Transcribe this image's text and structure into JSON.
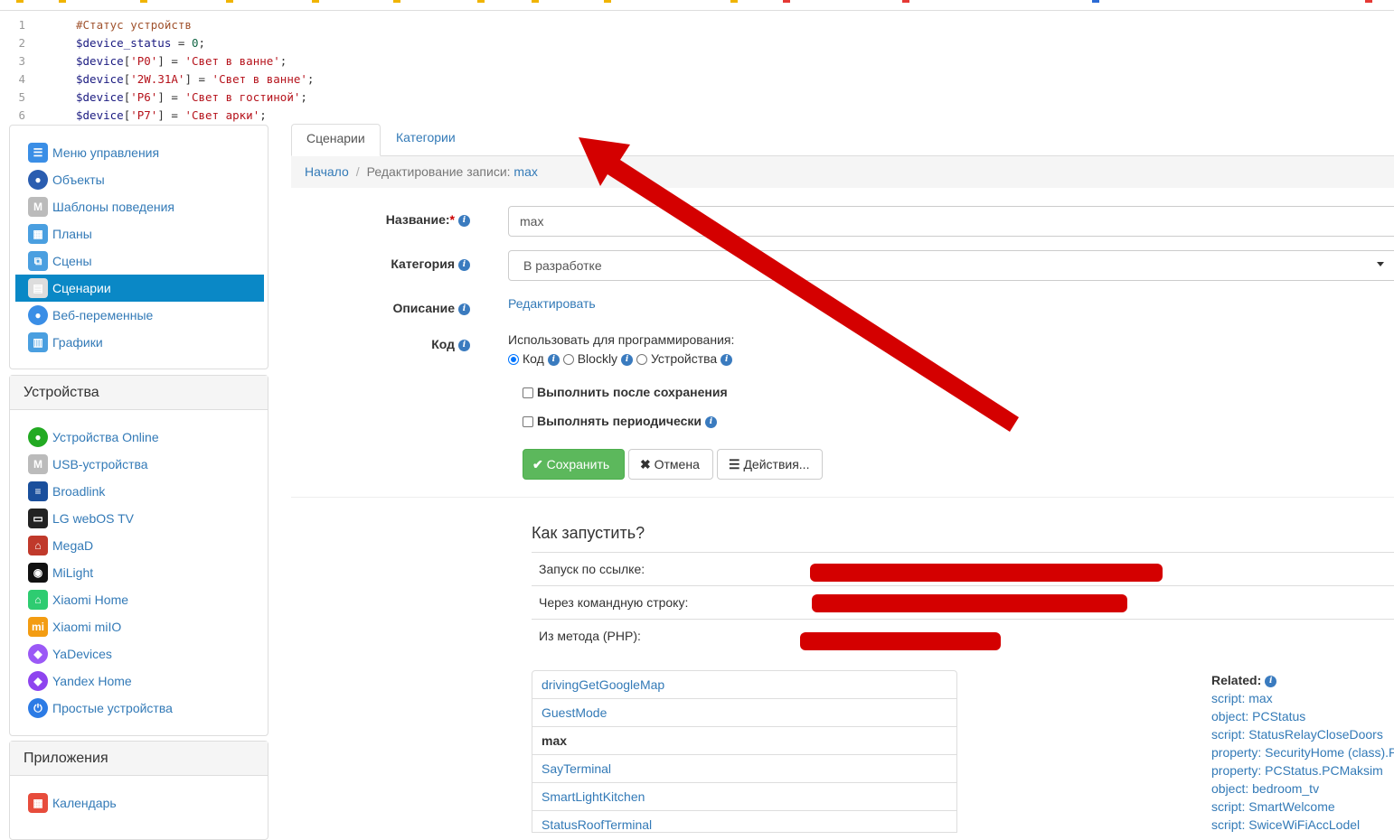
{
  "code": {
    "lines": [
      {
        "num": "1",
        "parts": [
          {
            "t": "#Статус устройств",
            "c": "c-cmt"
          }
        ]
      },
      {
        "num": "2",
        "parts": [
          {
            "t": "$device_status",
            "c": "c-var"
          },
          {
            "t": " = ",
            "c": ""
          },
          {
            "t": "0",
            "c": "c-num"
          },
          {
            "t": ";",
            "c": ""
          }
        ]
      },
      {
        "num": "3",
        "parts": [
          {
            "t": "$device",
            "c": "c-var"
          },
          {
            "t": "[",
            "c": ""
          },
          {
            "t": "'P0'",
            "c": "c-key"
          },
          {
            "t": "] = ",
            "c": ""
          },
          {
            "t": "'Свет в ванне'",
            "c": "c-str"
          },
          {
            "t": ";",
            "c": ""
          }
        ]
      },
      {
        "num": "4",
        "parts": [
          {
            "t": "$device",
            "c": "c-var"
          },
          {
            "t": "[",
            "c": ""
          },
          {
            "t": "'2W.31A'",
            "c": "c-key"
          },
          {
            "t": "] = ",
            "c": ""
          },
          {
            "t": "'Свет в ванне'",
            "c": "c-str"
          },
          {
            "t": ";",
            "c": ""
          }
        ]
      },
      {
        "num": "5",
        "parts": [
          {
            "t": "$device",
            "c": "c-var"
          },
          {
            "t": "[",
            "c": ""
          },
          {
            "t": "'P6'",
            "c": "c-key"
          },
          {
            "t": "] = ",
            "c": ""
          },
          {
            "t": "'Свет в гостиной'",
            "c": "c-str"
          },
          {
            "t": ";",
            "c": ""
          }
        ]
      },
      {
        "num": "6",
        "parts": [
          {
            "t": "$device",
            "c": "c-var"
          },
          {
            "t": "[",
            "c": ""
          },
          {
            "t": "'P7'",
            "c": "c-key"
          },
          {
            "t": "] = ",
            "c": ""
          },
          {
            "t": "'Свет арки'",
            "c": "c-str"
          },
          {
            "t": ";",
            "c": ""
          }
        ]
      }
    ]
  },
  "sidebar": {
    "main_items": [
      {
        "label": "Меню управления",
        "icon": "menu-icon",
        "color": "#3a8ee6"
      },
      {
        "label": "Объекты",
        "icon": "globe-icon",
        "color": "#2a5db0"
      },
      {
        "label": "Шаблоны поведения",
        "icon": "template-icon",
        "color": "#bbbbbb"
      },
      {
        "label": "Планы",
        "icon": "plan-icon",
        "color": "#4a9fe0"
      },
      {
        "label": "Сцены",
        "icon": "scene-icon",
        "color": "#4a9fe0"
      },
      {
        "label": "Сценарии",
        "icon": "script-icon",
        "color": "#dddddd",
        "active": true
      },
      {
        "label": "Веб-переменные",
        "icon": "web-globe-icon",
        "color": "#3a8ee6"
      },
      {
        "label": "Графики",
        "icon": "chart-icon",
        "color": "#4a9fe0"
      }
    ],
    "devices_title": "Устройства",
    "device_items": [
      {
        "label": "Устройства Online",
        "icon": "online-icon",
        "color": "#22aa22"
      },
      {
        "label": "USB-устройства",
        "icon": "usb-icon",
        "color": "#bbbbbb"
      },
      {
        "label": "Broadlink",
        "icon": "broadlink-icon",
        "color": "#1a4f9c"
      },
      {
        "label": "LG webOS TV",
        "icon": "lg-tv-icon",
        "color": "#222222"
      },
      {
        "label": "MegaD",
        "icon": "home-icon",
        "color": "#c0392b"
      },
      {
        "label": "MiLight",
        "icon": "milight-icon",
        "color": "#111111"
      },
      {
        "label": "Xiaomi Home",
        "icon": "xiaomi-home-icon",
        "color": "#2ecc71"
      },
      {
        "label": "Xiaomi miIO",
        "icon": "xiaomi-mi-icon",
        "color": "#f39c12"
      },
      {
        "label": "YaDevices",
        "icon": "alice-icon",
        "color": "#9b59f6"
      },
      {
        "label": "Yandex Home",
        "icon": "yandex-home-icon",
        "color": "#8e44ef"
      },
      {
        "label": "Простые устройства",
        "icon": "power-icon",
        "color": "#2c7be5"
      }
    ],
    "apps_title": "Приложения",
    "app_items": [
      {
        "label": "Календарь",
        "icon": "calendar-icon",
        "color": "#e74c3c"
      }
    ]
  },
  "tabs": [
    {
      "label": "Сценарии",
      "active": true
    },
    {
      "label": "Категории",
      "active": false
    }
  ],
  "breadcrumb": {
    "home": "Начало",
    "current_prefix": "Редактирование записи:",
    "current_name": "max"
  },
  "form": {
    "name_label": "Название:",
    "required_mark": "*",
    "name_value": "max",
    "category_label": "Категория",
    "category_value": "В разработке",
    "description_label": "Описание",
    "description_link": "Редактировать",
    "code_label": "Код",
    "use_for_label": "Использовать для программирования:",
    "mode_options": [
      {
        "label": "Код",
        "checked": true
      },
      {
        "label": "Blockly",
        "checked": false
      },
      {
        "label": "Устройства",
        "checked": false
      }
    ],
    "run_after_save": "Выполнить после сохранения",
    "run_periodic": "Выполнять периодически",
    "save_button": "Сохранить",
    "cancel_button": "Отмена",
    "actions_button": "Действия..."
  },
  "how_to_run": {
    "title": "Как запустить?",
    "rows": [
      {
        "label": "Запуск по ссылке:"
      },
      {
        "label": "Через командную строку:"
      },
      {
        "label": "Из метода (PHP):"
      }
    ]
  },
  "script_list": [
    {
      "name": "drivingGetGoogleMap",
      "current": false
    },
    {
      "name": "GuestMode",
      "current": false
    },
    {
      "name": "max",
      "current": true
    },
    {
      "name": "SayTerminal",
      "current": false
    },
    {
      "name": "SmartLightKitchen",
      "current": false
    },
    {
      "name": "StatusRoofTerminal",
      "current": false
    }
  ],
  "related": {
    "title": "Related:",
    "items": [
      "script: max",
      "object: PCStatus",
      "script: StatusRelayCloseDoors",
      "property: SecurityHome (class).P",
      "property: PCStatus.PCMaksim",
      "object: bedroom_tv",
      "script: SmartWelcome",
      "script: SwiceWiFiAccLodel"
    ]
  },
  "colors": {
    "accent": "#0a88c6",
    "link": "#337ab7",
    "success": "#5cb85c",
    "annotation_red": "#d40000"
  }
}
